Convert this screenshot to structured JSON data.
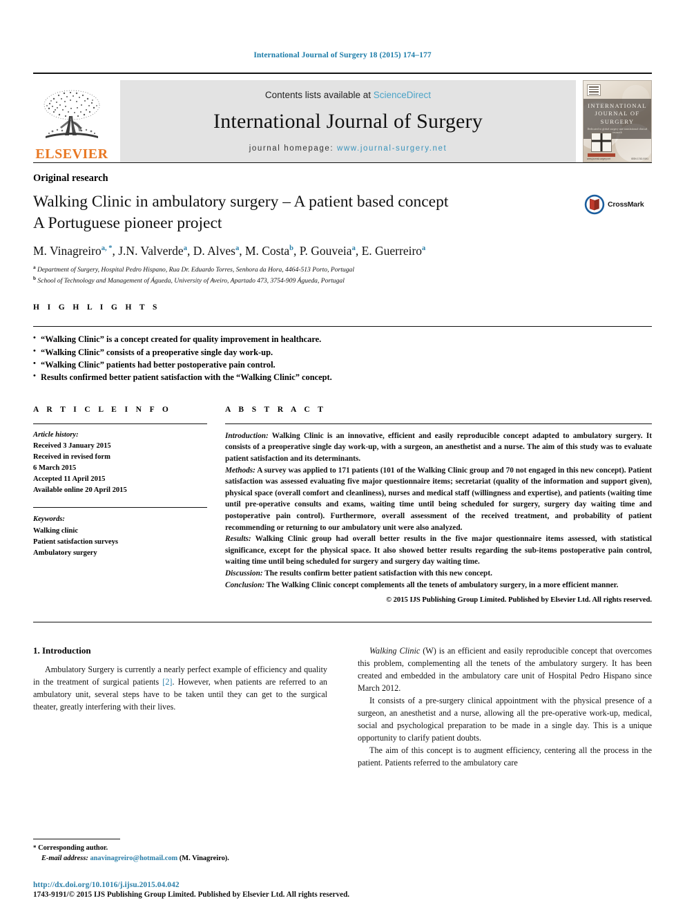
{
  "running_head": "International Journal of Surgery 18 (2015) 174–177",
  "masthead": {
    "contents_prefix": "Contents lists available at",
    "sciencedirect": "ScienceDirect",
    "journal_name": "International Journal of Surgery",
    "homepage_prefix": "journal homepage:",
    "homepage_url": "www.journal-surgery.net",
    "publisher_word": "ELSEVIER",
    "publisher_color": "#E87722",
    "link_color": "#3a93bb"
  },
  "cover": {
    "title_line1": "INTERNATIONAL",
    "title_line2": "JOURNAL OF SURGERY",
    "subtitle": "Dedicated to global surgery and translational clinical research",
    "footer_right": "ISSN 1743-9191",
    "footer_left": "www.journal-surgery.net"
  },
  "article": {
    "type": "Original research",
    "title_line1": "Walking Clinic in ambulatory surgery – A patient based concept",
    "title_line2": "A Portuguese pioneer project",
    "crossmark_label": "CrossMark",
    "authors": [
      {
        "name": "M. Vinagreiro",
        "marks": "a, *"
      },
      {
        "name": "J.N. Valverde",
        "marks": "a"
      },
      {
        "name": "D. Alves",
        "marks": "a"
      },
      {
        "name": "M. Costa",
        "marks": "b"
      },
      {
        "name": "P. Gouveia",
        "marks": "a"
      },
      {
        "name": "E. Guerreiro",
        "marks": "a"
      }
    ],
    "affiliations": [
      {
        "mark": "a",
        "text": "Department of Surgery, Hospital Pedro Hispano, Rua Dr. Eduardo Torres, Senhora da Hora, 4464-513 Porto, Portugal"
      },
      {
        "mark": "b",
        "text": "School of Technology and Management of Águeda, University of Aveiro, Apartado 473, 3754-909 Águeda, Portugal"
      }
    ]
  },
  "highlights": {
    "label": "H I G H L I G H T S",
    "items": [
      "“Walking Clinic” is a concept created for quality improvement in healthcare.",
      "“Walking Clinic” consists of a preoperative single day work-up.",
      "“Walking Clinic” patients had better postoperative pain control.",
      "Results confirmed better patient satisfaction with the “Walking Clinic” concept."
    ]
  },
  "article_info": {
    "label": "A R T I C L E   I N F O",
    "history_lead": "Article history:",
    "history": [
      "Received 3 January 2015",
      "Received in revised form",
      "6 March 2015",
      "Accepted 11 April 2015",
      "Available online 20 April 2015"
    ],
    "keywords_lead": "Keywords:",
    "keywords": [
      "Walking clinic",
      "Patient satisfaction surveys",
      "Ambulatory surgery"
    ]
  },
  "abstract": {
    "label": "A B S T R A C T",
    "introduction_lead": "Introduction:",
    "introduction": " Walking Clinic is an innovative, efficient and easily reproducible concept adapted to ambulatory surgery. It consists of a preoperative single day work-up, with a surgeon, an anesthetist and a nurse. The aim of this study was to evaluate patient satisfaction and its determinants.",
    "methods_lead": "Methods:",
    "methods": " A survey was applied to 171 patients (101 of the Walking Clinic group and 70 not engaged in this new concept). Patient satisfaction was assessed evaluating five major questionnaire items; secretariat (quality of the information and support given), physical space (overall comfort and cleanliness), nurses and medical staff (willingness and expertise), and patients (waiting time until pre-operative consults and exams, waiting time until being scheduled for surgery, surgery day waiting time and postoperative pain control). Furthermore, overall assessment of the received treatment, and probability of patient recommending or returning to our ambulatory unit were also analyzed.",
    "results_lead": "Results:",
    "results": " Walking Clinic group had overall better results in the five major questionnaire items assessed, with statistical significance, except for the physical space. It also showed better results regarding the sub-items postoperative pain control, waiting time until being scheduled for surgery and surgery day waiting time.",
    "discussion_lead": "Discussion:",
    "discussion": " The results confirm better patient satisfaction with this new concept.",
    "conclusion_lead": "Conclusion:",
    "conclusion": " The Walking Clinic concept complements all the tenets of ambulatory surgery, in a more efficient manner.",
    "copyright": "© 2015 IJS Publishing Group Limited. Published by Elsevier Ltd. All rights reserved."
  },
  "body": {
    "section_heading": "1. Introduction",
    "left_para_1_a": "Ambulatory Surgery is currently a nearly perfect example of efficiency and quality in the treatment of surgical patients ",
    "left_para_1_cite": "[2]",
    "left_para_1_b": ". However, when patients are referred to an ambulatory unit, several steps have to be taken until they can get to the surgical theater, greatly interfering with their lives.",
    "right_para_1": "Walking Clinic (W) is an efficient and easily reproducible concept that overcomes this problem, complementing all the tenets of the ambulatory surgery. It has been created and embedded in the ambulatory care unit of Hospital Pedro Hispano since March 2012.",
    "right_para_2": "It consists of a pre-surgery clinical appointment with the physical presence of a surgeon, an anesthetist and a nurse, allowing all the pre-operative work-up, medical, social and psychological preparation to be made in a single day. This is a unique opportunity to clarify patient doubts.",
    "right_para_3": "The aim of this concept is to augment efficiency, centering all the process in the patient. Patients referred to the ambulatory care"
  },
  "footnote": {
    "corresponding": "Corresponding author.",
    "email_lead": "E-mail address:",
    "email": "anavinagreiro@hotmail.com",
    "email_suffix": " (M. Vinagreiro)."
  },
  "footer": {
    "doi": "http://dx.doi.org/10.1016/j.ijsu.2015.04.042",
    "issn": "1743-9191/© 2015 IJS Publishing Group Limited. Published by Elsevier Ltd. All rights reserved."
  }
}
